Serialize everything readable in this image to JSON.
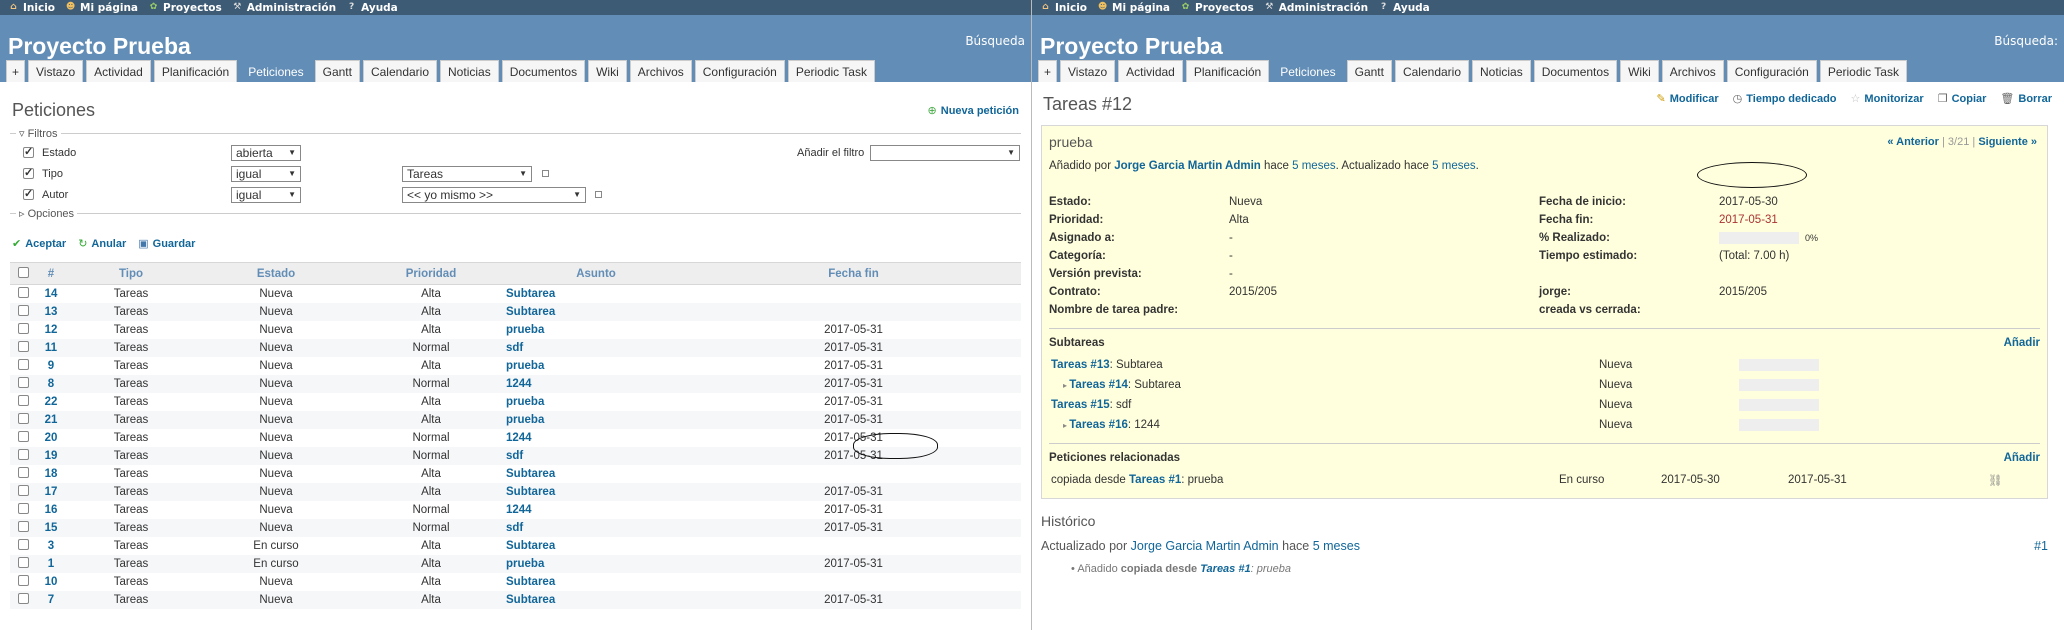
{
  "top_menu": [
    "Inicio",
    "Mi página",
    "Proyectos",
    "Administración",
    "Ayuda"
  ],
  "project_title": "Proyecto Prueba",
  "search_label": "Búsqueda",
  "search_label_right": "Búsqueda:",
  "tabs": [
    "+",
    "Vistazo",
    "Actividad",
    "Planificación",
    "Peticiones",
    "Gantt",
    "Calendario",
    "Noticias",
    "Documentos",
    "Wiki",
    "Archivos",
    "Configuración",
    "Periodic Task"
  ],
  "selected_tab": "Peticiones",
  "left": {
    "title": "Peticiones",
    "new_issue": "Nueva petición",
    "filters_legend": "Filtros",
    "options_legend": "Opciones",
    "add_filter_label": "Añadir el filtro",
    "filters": [
      {
        "label": "Estado",
        "op": "abierta",
        "value": ""
      },
      {
        "label": "Tipo",
        "op": "igual",
        "value": "Tareas"
      },
      {
        "label": "Autor",
        "op": "igual",
        "value": "<< yo mismo >>"
      }
    ],
    "buttons": [
      "Aceptar",
      "Anular",
      "Guardar"
    ],
    "columns": [
      "#",
      "Tipo",
      "Estado",
      "Prioridad",
      "Asunto",
      "Fecha fin"
    ],
    "rows": [
      [
        "14",
        "Tareas",
        "Nueva",
        "Alta",
        "Subtarea",
        ""
      ],
      [
        "13",
        "Tareas",
        "Nueva",
        "Alta",
        "Subtarea",
        ""
      ],
      [
        "12",
        "Tareas",
        "Nueva",
        "Alta",
        "prueba",
        "2017-05-31"
      ],
      [
        "11",
        "Tareas",
        "Nueva",
        "Normal",
        "sdf",
        "2017-05-31"
      ],
      [
        "9",
        "Tareas",
        "Nueva",
        "Alta",
        "prueba",
        "2017-05-31"
      ],
      [
        "8",
        "Tareas",
        "Nueva",
        "Normal",
        "1244",
        "2017-05-31"
      ],
      [
        "22",
        "Tareas",
        "Nueva",
        "Alta",
        "prueba",
        "2017-05-31"
      ],
      [
        "21",
        "Tareas",
        "Nueva",
        "Alta",
        "prueba",
        "2017-05-31"
      ],
      [
        "20",
        "Tareas",
        "Nueva",
        "Normal",
        "1244",
        "2017-05-31"
      ],
      [
        "19",
        "Tareas",
        "Nueva",
        "Normal",
        "sdf",
        "2017-05-31"
      ],
      [
        "18",
        "Tareas",
        "Nueva",
        "Alta",
        "Subtarea",
        ""
      ],
      [
        "17",
        "Tareas",
        "Nueva",
        "Alta",
        "Subtarea",
        "2017-05-31"
      ],
      [
        "16",
        "Tareas",
        "Nueva",
        "Normal",
        "1244",
        "2017-05-31"
      ],
      [
        "15",
        "Tareas",
        "Nueva",
        "Normal",
        "sdf",
        "2017-05-31"
      ],
      [
        "3",
        "Tareas",
        "En curso",
        "Alta",
        "Subtarea",
        ""
      ],
      [
        "1",
        "Tareas",
        "En curso",
        "Alta",
        "prueba",
        "2017-05-31"
      ],
      [
        "10",
        "Tareas",
        "Nueva",
        "Alta",
        "Subtarea",
        ""
      ],
      [
        "7",
        "Tareas",
        "Nueva",
        "Alta",
        "Subtarea",
        "2017-05-31"
      ]
    ]
  },
  "right": {
    "title": "Tareas #12",
    "actions": [
      "Modificar",
      "Tiempo dedicado",
      "Monitorizar",
      "Copiar",
      "Borrar"
    ],
    "subject": "prueba",
    "nav_prev": "« Anterior",
    "nav_pos": "3/21",
    "nav_next": "Siguiente »",
    "added_by_prefix": "Añadido por",
    "author": "Jorge Garcia Martin Admin",
    "hace": "hace",
    "added_ago": "5 meses",
    "updated_text": ". Actualizado hace",
    "updated_ago": "5 meses",
    "attrs_left": [
      [
        "Estado:",
        "Nueva"
      ],
      [
        "Prioridad:",
        "Alta"
      ],
      [
        "Asignado a:",
        "-"
      ],
      [
        "Categoría:",
        "-"
      ],
      [
        "Versión prevista:",
        "-"
      ],
      [
        "Contrato:",
        "2015/205"
      ],
      [
        "Nombre de tarea padre:",
        ""
      ]
    ],
    "attrs_right": [
      [
        "Fecha de inicio:",
        "2017-05-30"
      ],
      [
        "Fecha fin:",
        "2017-05-31"
      ],
      [
        "% Realizado:",
        "0%"
      ],
      [
        "Tiempo estimado:",
        "(Total: 7.00 h)"
      ],
      [
        "",
        ""
      ],
      [
        "jorge:",
        "2015/205"
      ],
      [
        "creada vs cerrada:",
        ""
      ]
    ],
    "done_ratio": 0,
    "subtasks_title": "Subtareas",
    "add_label": "Añadir",
    "subtasks": [
      {
        "link": "Tareas #13",
        "subject": ": Subtarea",
        "status": "Nueva",
        "indent": false
      },
      {
        "link": "Tareas #14",
        "subject": ": Subtarea",
        "status": "Nueva",
        "indent": true
      },
      {
        "link": "Tareas #15",
        "subject": ": sdf",
        "status": "Nueva",
        "indent": false
      },
      {
        "link": "Tareas #16",
        "subject": ": 1244",
        "status": "Nueva",
        "indent": true
      }
    ],
    "related_title": "Peticiones relacionadas",
    "related": {
      "prefix": "copiada desde",
      "link": "Tareas #1",
      "subject": ": prueba",
      "status": "En curso",
      "start": "2017-05-30",
      "end": "2017-05-31"
    },
    "history_title": "Histórico",
    "journal_prefix": "Actualizado por",
    "journal_author": "Jorge Garcia Martin Admin",
    "journal_ago": "5 meses",
    "journal_num": "#1",
    "journal_detail": {
      "prefix": "Añadido",
      "strong": "copiada desde",
      "link": "Tareas #1",
      "rest": ": prueba"
    }
  }
}
